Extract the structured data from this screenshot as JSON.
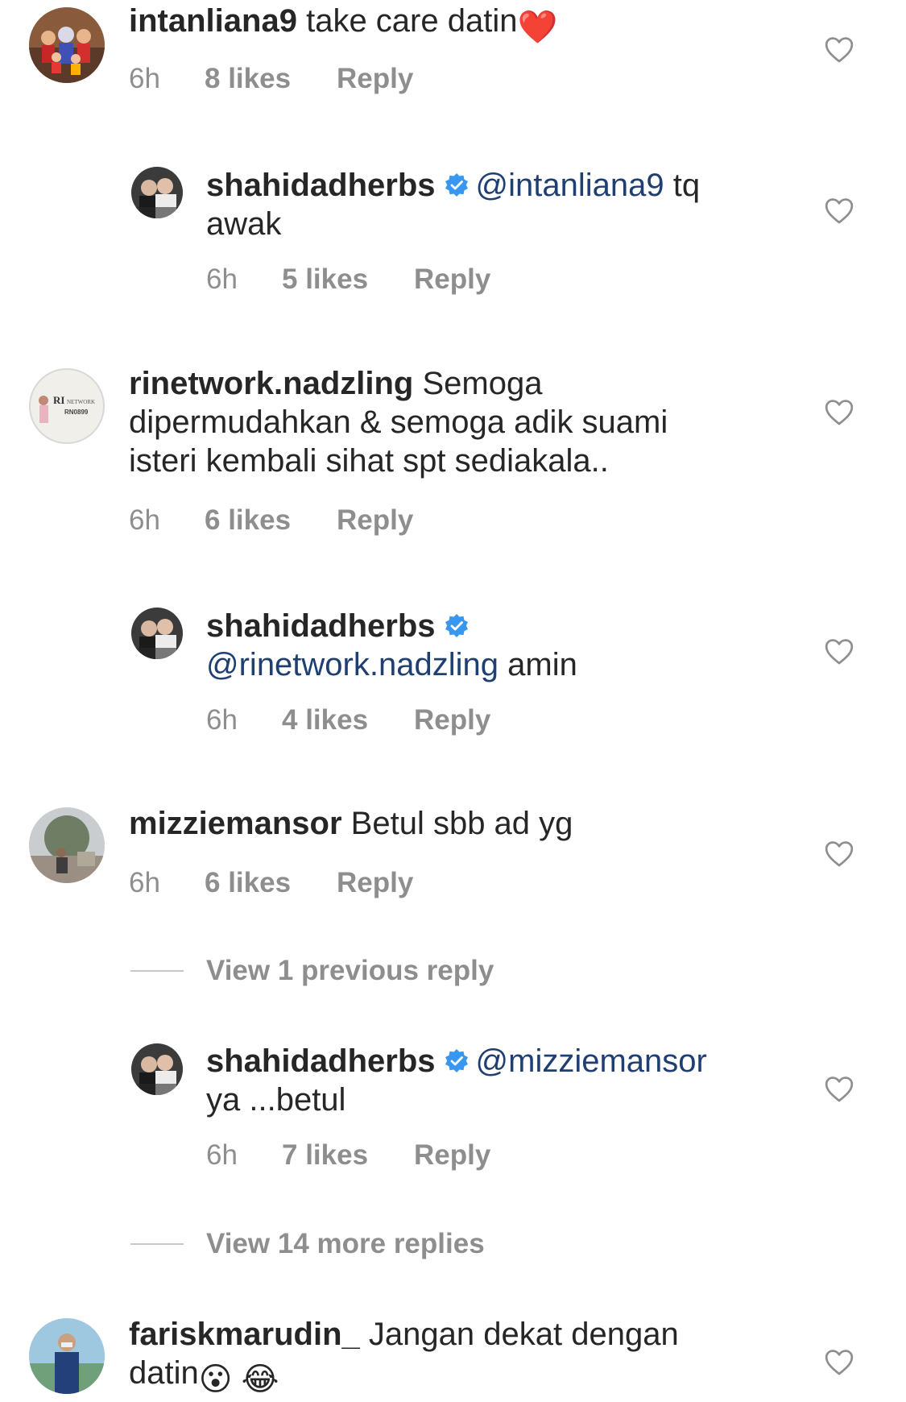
{
  "comments": [
    {
      "username": "intanliana9",
      "text": "take care datin",
      "emoji": "❤️",
      "time": "6h",
      "likes": "8 likes",
      "reply": "Reply"
    },
    {
      "username": "shahidadherbs",
      "mention": "@intanliana9",
      "text": "tq awak",
      "time": "6h",
      "likes": "5 likes",
      "reply": "Reply"
    },
    {
      "username": "rinetwork.nadzling",
      "text": "Semoga dipermudahkan & semoga adik suami isteri kembali sihat spt sediakala..",
      "avatar_text_1": "RI",
      "avatar_text_2": "NETWORK",
      "avatar_text_3": "RN0899",
      "time": "6h",
      "likes": "6 likes",
      "reply": "Reply"
    },
    {
      "username": "shahidadherbs",
      "mention": "@rinetwork.nadzling",
      "text": "amin",
      "time": "6h",
      "likes": "4 likes",
      "reply": "Reply"
    },
    {
      "username": "mizziemansor",
      "text": "Betul sbb ad yg",
      "time": "6h",
      "likes": "6 likes",
      "reply": "Reply"
    },
    {
      "username": "shahidadherbs",
      "mention": "@mizziemansor",
      "text": "ya ...betul",
      "time": "6h",
      "likes": "7 likes",
      "reply": "Reply"
    },
    {
      "username": "fariskmarudin_",
      "text": "Jangan dekat dengan datin",
      "emoji_1": "😮",
      "emoji_2": "😂"
    }
  ],
  "view_previous": "View 1 previous reply",
  "view_more": "View 14 more replies",
  "icons": {
    "like": "heart-outline-icon",
    "verified": "verified-badge-icon"
  },
  "colors": {
    "text": "#262626",
    "meta": "#8e8e8e",
    "mention": "#1f3f72",
    "verified": "#3897f0",
    "heart_emoji": "#e0245e"
  }
}
